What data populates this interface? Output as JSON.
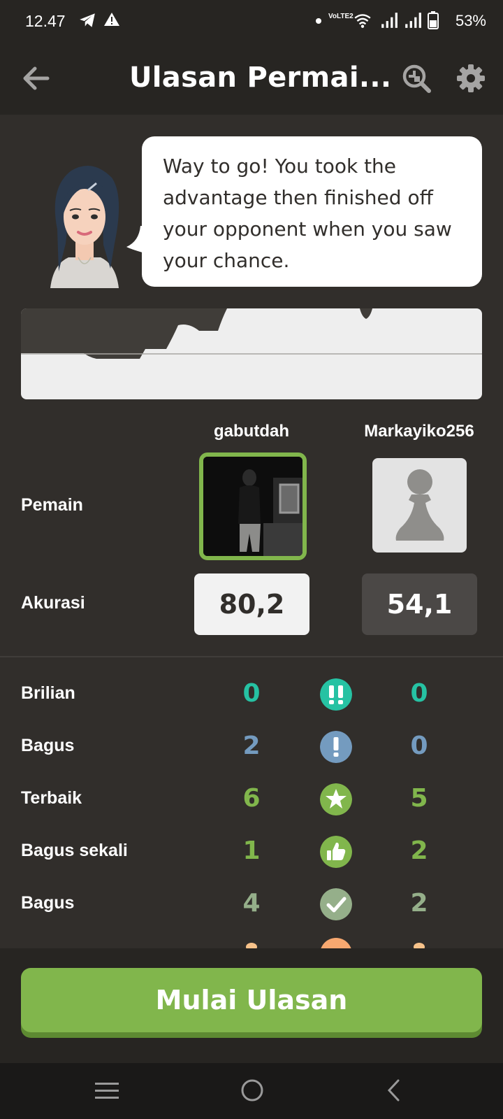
{
  "status_bar": {
    "time": "12.47",
    "network_label": "VoLTE2",
    "battery": "53%"
  },
  "app_bar": {
    "title": "Ulasan Permai..."
  },
  "coach": {
    "message": "Way to go! You took the advantage then finished off your opponent when you saw your chance."
  },
  "players": {
    "row_label": "Pemain",
    "white_name": "gabutdah",
    "black_name": "Markayiko256"
  },
  "accuracy": {
    "label": "Akurasi",
    "white": "80,2",
    "black": "54,1"
  },
  "classifications": [
    {
      "label": "Brilian",
      "white": "0",
      "black": "0",
      "icon": "brilliant-icon",
      "color": "#26c2a3"
    },
    {
      "label": "Bagus",
      "white": "2",
      "black": "0",
      "icon": "great-move-icon",
      "color": "#749bbf"
    },
    {
      "label": "Terbaik",
      "white": "6",
      "black": "5",
      "icon": "best-move-star-icon",
      "color": "#81b64c"
    },
    {
      "label": "Bagus sekali",
      "white": "1",
      "black": "2",
      "icon": "excellent-thumbs-up-icon",
      "color": "#81b64c"
    },
    {
      "label": "Bagus",
      "white": "4",
      "black": "2",
      "icon": "good-move-check-icon",
      "color": "#95af8a"
    }
  ],
  "cta": {
    "label": "Mulai Ulasan",
    "color": "#81b64c"
  }
}
